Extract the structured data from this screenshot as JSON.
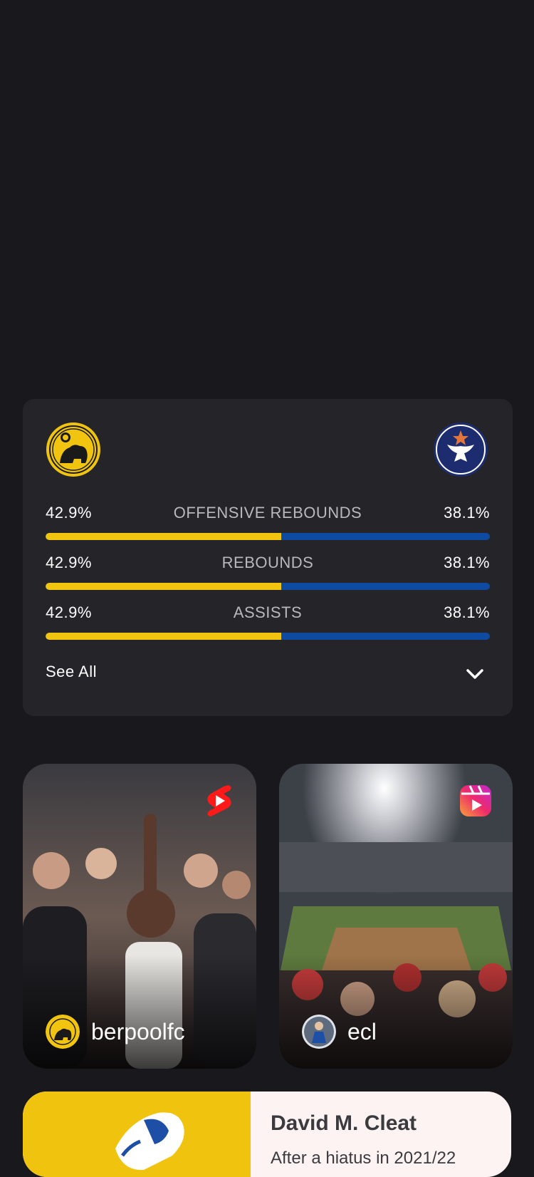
{
  "match_stats": {
    "home_team": {
      "logo": "bear-crest-icon",
      "color": "#f1c40f"
    },
    "away_team": {
      "logo": "eagle-crest-icon",
      "color": "#0e4aa0"
    },
    "rows": [
      {
        "label": "OFFENSIVE REBOUNDS",
        "home": "42.9%",
        "away": "38.1%",
        "home_share": 0.53
      },
      {
        "label": "REBOUNDS",
        "home": "42.9%",
        "away": "38.1%",
        "home_share": 0.53
      },
      {
        "label": "ASSISTS",
        "home": "42.9%",
        "away": "38.1%",
        "home_share": 0.53
      }
    ],
    "see_all_label": "See All",
    "expand_icon": "chevron-down-icon"
  },
  "reels": [
    {
      "handle": "berpoolfc",
      "platform_icon": "youtube-shorts-icon",
      "avatar": "bear-crest-icon"
    },
    {
      "handle": "ecl",
      "platform_icon": "instagram-reels-icon",
      "avatar": "player-avatar-icon"
    }
  ],
  "article": {
    "title": "David M. Cleat",
    "snippet": "After a hiatus in 2021/22"
  }
}
